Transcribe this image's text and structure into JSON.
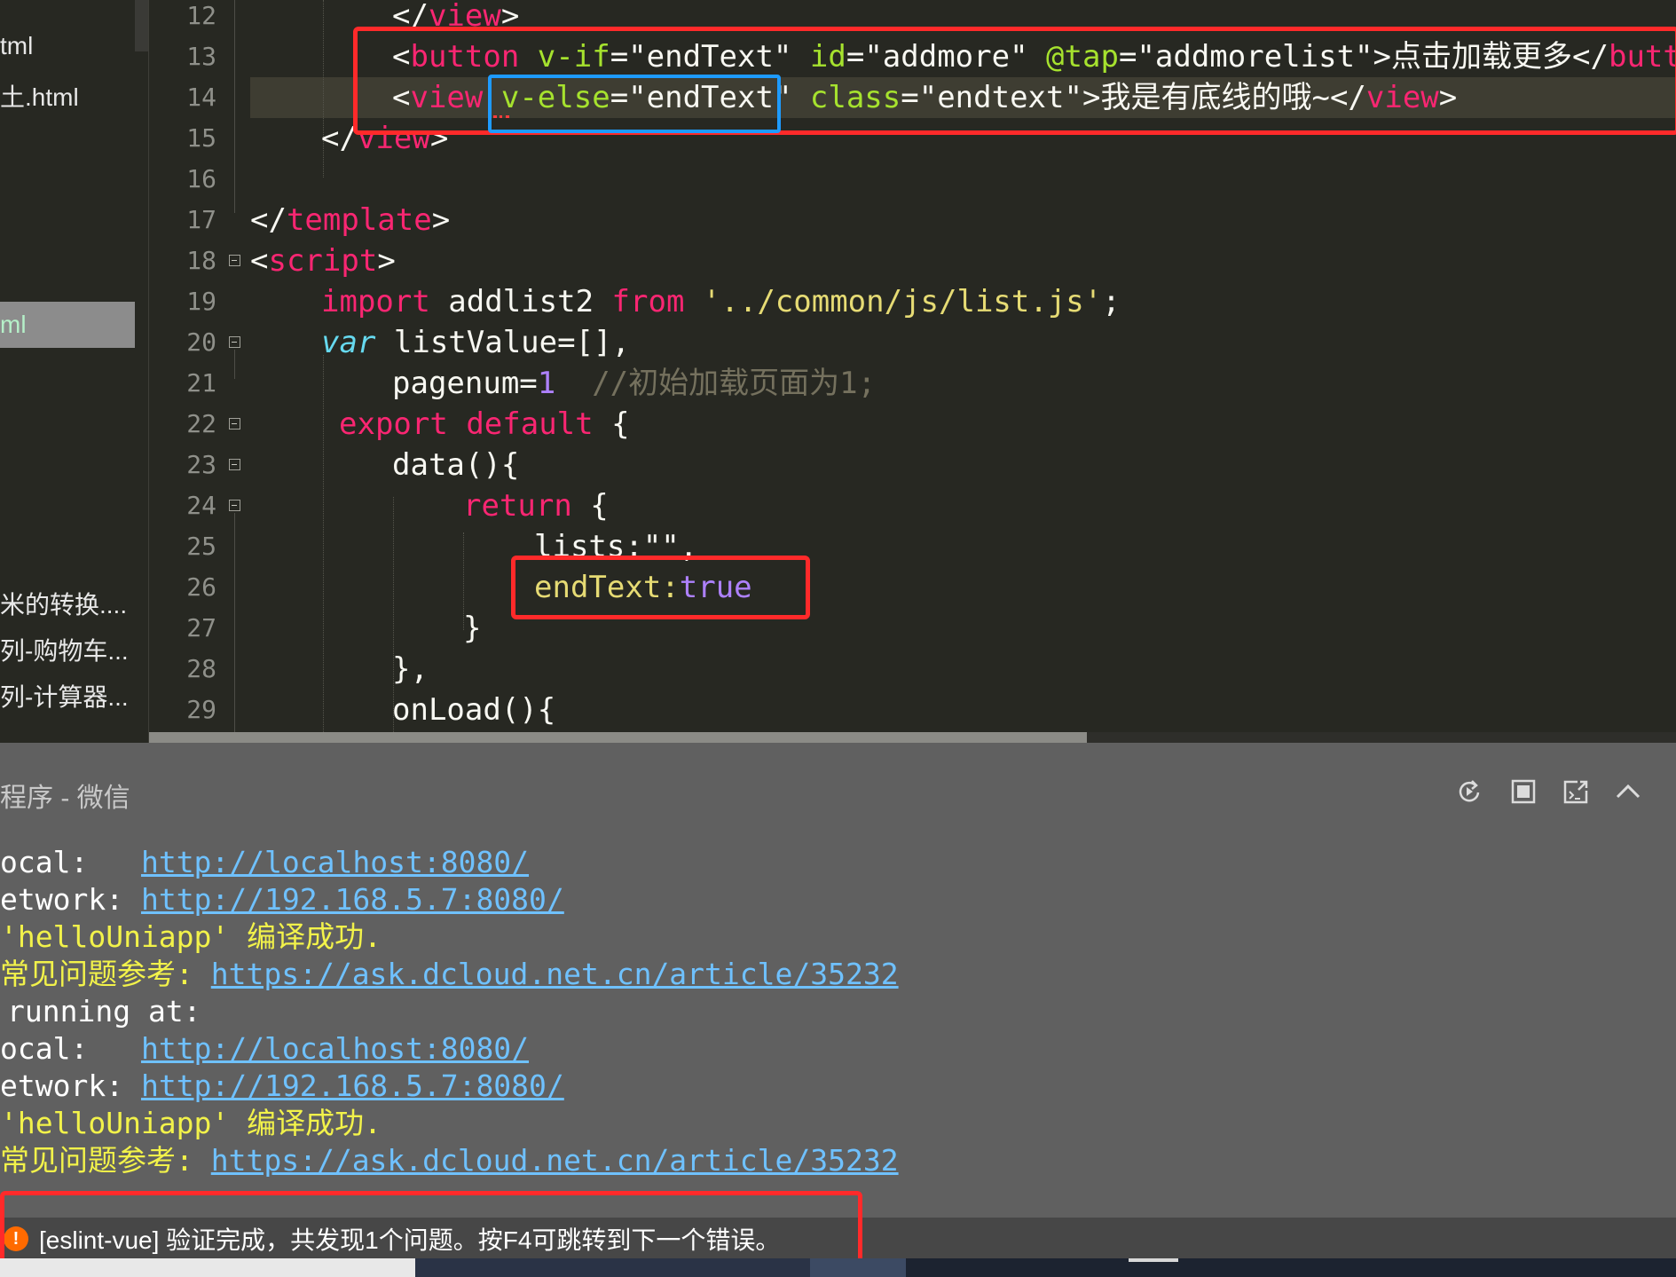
{
  "sidebar": {
    "items": [
      {
        "label": "tml"
      },
      {
        "label": "土.html"
      },
      {
        "label": "ml",
        "selected": true
      },
      {
        "label": "米的转换...."
      },
      {
        "label": "列-购物车..."
      },
      {
        "label": "列-计算器..."
      }
    ]
  },
  "editor": {
    "line_numbers": [
      "12",
      "13",
      "14",
      "15",
      "16",
      "17",
      "18",
      "19",
      "20",
      "21",
      "22",
      "23",
      "24",
      "25",
      "26",
      "27",
      "28",
      "29"
    ],
    "lines": {
      "l12": {
        "close_open": "</",
        "tag": "view",
        "close_end": ">"
      },
      "l13": {
        "lt": "<",
        "tag": "button",
        "sp1": " ",
        "attr1": "v-if",
        "eq1": "=",
        "val1": "\"endText\"",
        "sp2": " ",
        "attr2": "id",
        "eq2": "=",
        "val2": "\"addmore\"",
        "sp3": " ",
        "attr3": "@tap",
        "eq3": "=",
        "val3": "\"addmorelist\"",
        "gt": ">",
        "text": "点击加载更多",
        "close_open": "</",
        "close_tag": "butto"
      },
      "l14": {
        "lt": "<",
        "tag": "view",
        "sp1": " ",
        "attr1": "v-else",
        "eq1": "=",
        "val1": "\"endText\"",
        "sp2": " ",
        "attr2": "class",
        "eq2": "=",
        "val2": "\"endtext\"",
        "gt": ">",
        "text": "我是有底线的哦~",
        "close_open": "</",
        "close_tag": "view",
        "close_end": ">"
      },
      "l15": {
        "close_open": "</",
        "tag": "view",
        "close_end": ">"
      },
      "l17": {
        "close_open": "</",
        "tag": "template",
        "close_end": ">"
      },
      "l18": {
        "lt": "<",
        "tag": "script",
        "gt": ">"
      },
      "l19": {
        "kw": "import",
        "name": " addlist2 ",
        "kw2": "from",
        "sp": " ",
        "str": "'../common/js/list.js'",
        "end": ";"
      },
      "l20": {
        "kw": "var",
        "rest": " listValue=[],"
      },
      "l21": {
        "name": "pagenum=",
        "num": "1",
        "sp": "  ",
        "comment": "//初始加载页面为1;"
      },
      "l22": {
        "kw": "export",
        "sp": " ",
        "kw2": "default",
        "rest": " {"
      },
      "l23": {
        "text": "data(){"
      },
      "l24": {
        "kw": "return",
        "rest": " {"
      },
      "l25": {
        "text": "lists:\"\","
      },
      "l26": {
        "name": "endText:",
        "val": "true"
      },
      "l27": {
        "text": "}"
      },
      "l28": {
        "text": "},"
      },
      "l29": {
        "text": "onLoad(){"
      }
    }
  },
  "console": {
    "title": "程序 - 微信",
    "lines": [
      {
        "label": "ocal:   ",
        "link": "http://localhost:8080/"
      },
      {
        "label": "etwork: ",
        "link": "http://192.168.5.7:8080/"
      },
      {
        "text": "'helloUniapp' 编译成功."
      },
      {
        "label": "常见问题参考: ",
        "link": "https://ask.dcloud.net.cn/article/35232"
      },
      {
        "plain": "running at:"
      },
      {
        "label": "ocal:   ",
        "link": "http://localhost:8080/"
      },
      {
        "label": "etwork: ",
        "link": "http://192.168.5.7:8080/"
      },
      {
        "text": "'helloUniapp' 编译成功."
      },
      {
        "label": "常见问题参考: ",
        "link": "https://ask.dcloud.net.cn/article/35232"
      }
    ],
    "controls": [
      "restart-icon",
      "stop-icon",
      "open-terminal-icon",
      "collapse-up-icon"
    ]
  },
  "status": {
    "warning_glyph": "!",
    "message": "[eslint-vue] 验证完成，共发现1个问题。按F4可跳转到下一个错误。"
  },
  "colors": {
    "editor_bg": "#272822",
    "tag": "#f92672",
    "attr": "#a6e22e",
    "string": "#e6db74",
    "number": "#ae81ff",
    "comment": "#75715e",
    "console_bg": "#606060",
    "link": "#6fc1ff",
    "success_text": "#f2f24a",
    "annotation_red": "#ff2a2a",
    "annotation_blue": "#1e9bff"
  }
}
